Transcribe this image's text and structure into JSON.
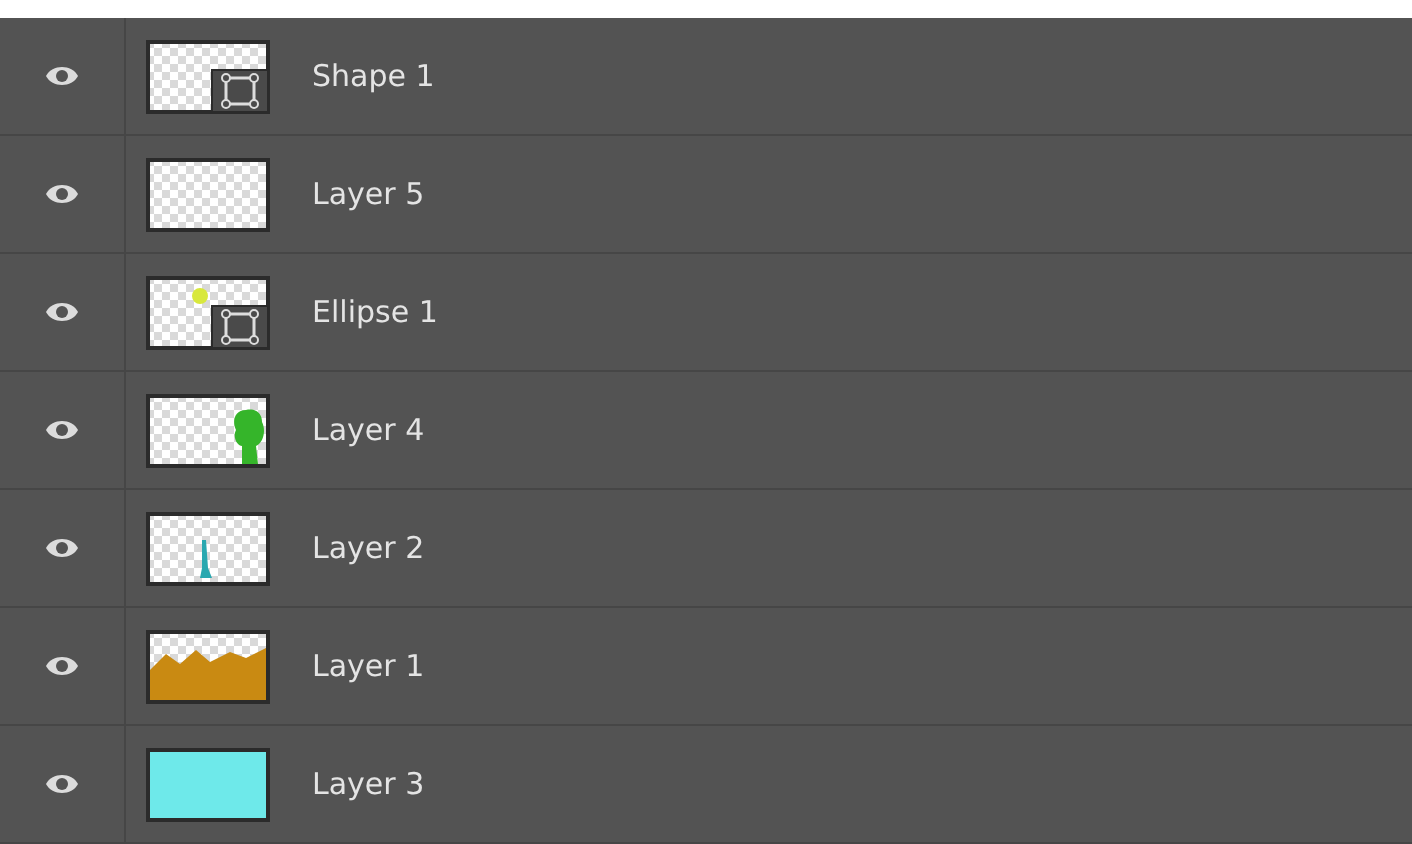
{
  "layers": [
    {
      "name": "Shape 1",
      "visible": true,
      "kind": "shape"
    },
    {
      "name": "Layer 5",
      "visible": true,
      "kind": "empty"
    },
    {
      "name": "Ellipse 1",
      "visible": true,
      "kind": "ellipse"
    },
    {
      "name": "Layer 4",
      "visible": true,
      "kind": "tree"
    },
    {
      "name": "Layer 2",
      "visible": true,
      "kind": "drip"
    },
    {
      "name": "Layer 1",
      "visible": true,
      "kind": "mountains"
    },
    {
      "name": "Layer 3",
      "visible": true,
      "kind": "fill"
    }
  ]
}
